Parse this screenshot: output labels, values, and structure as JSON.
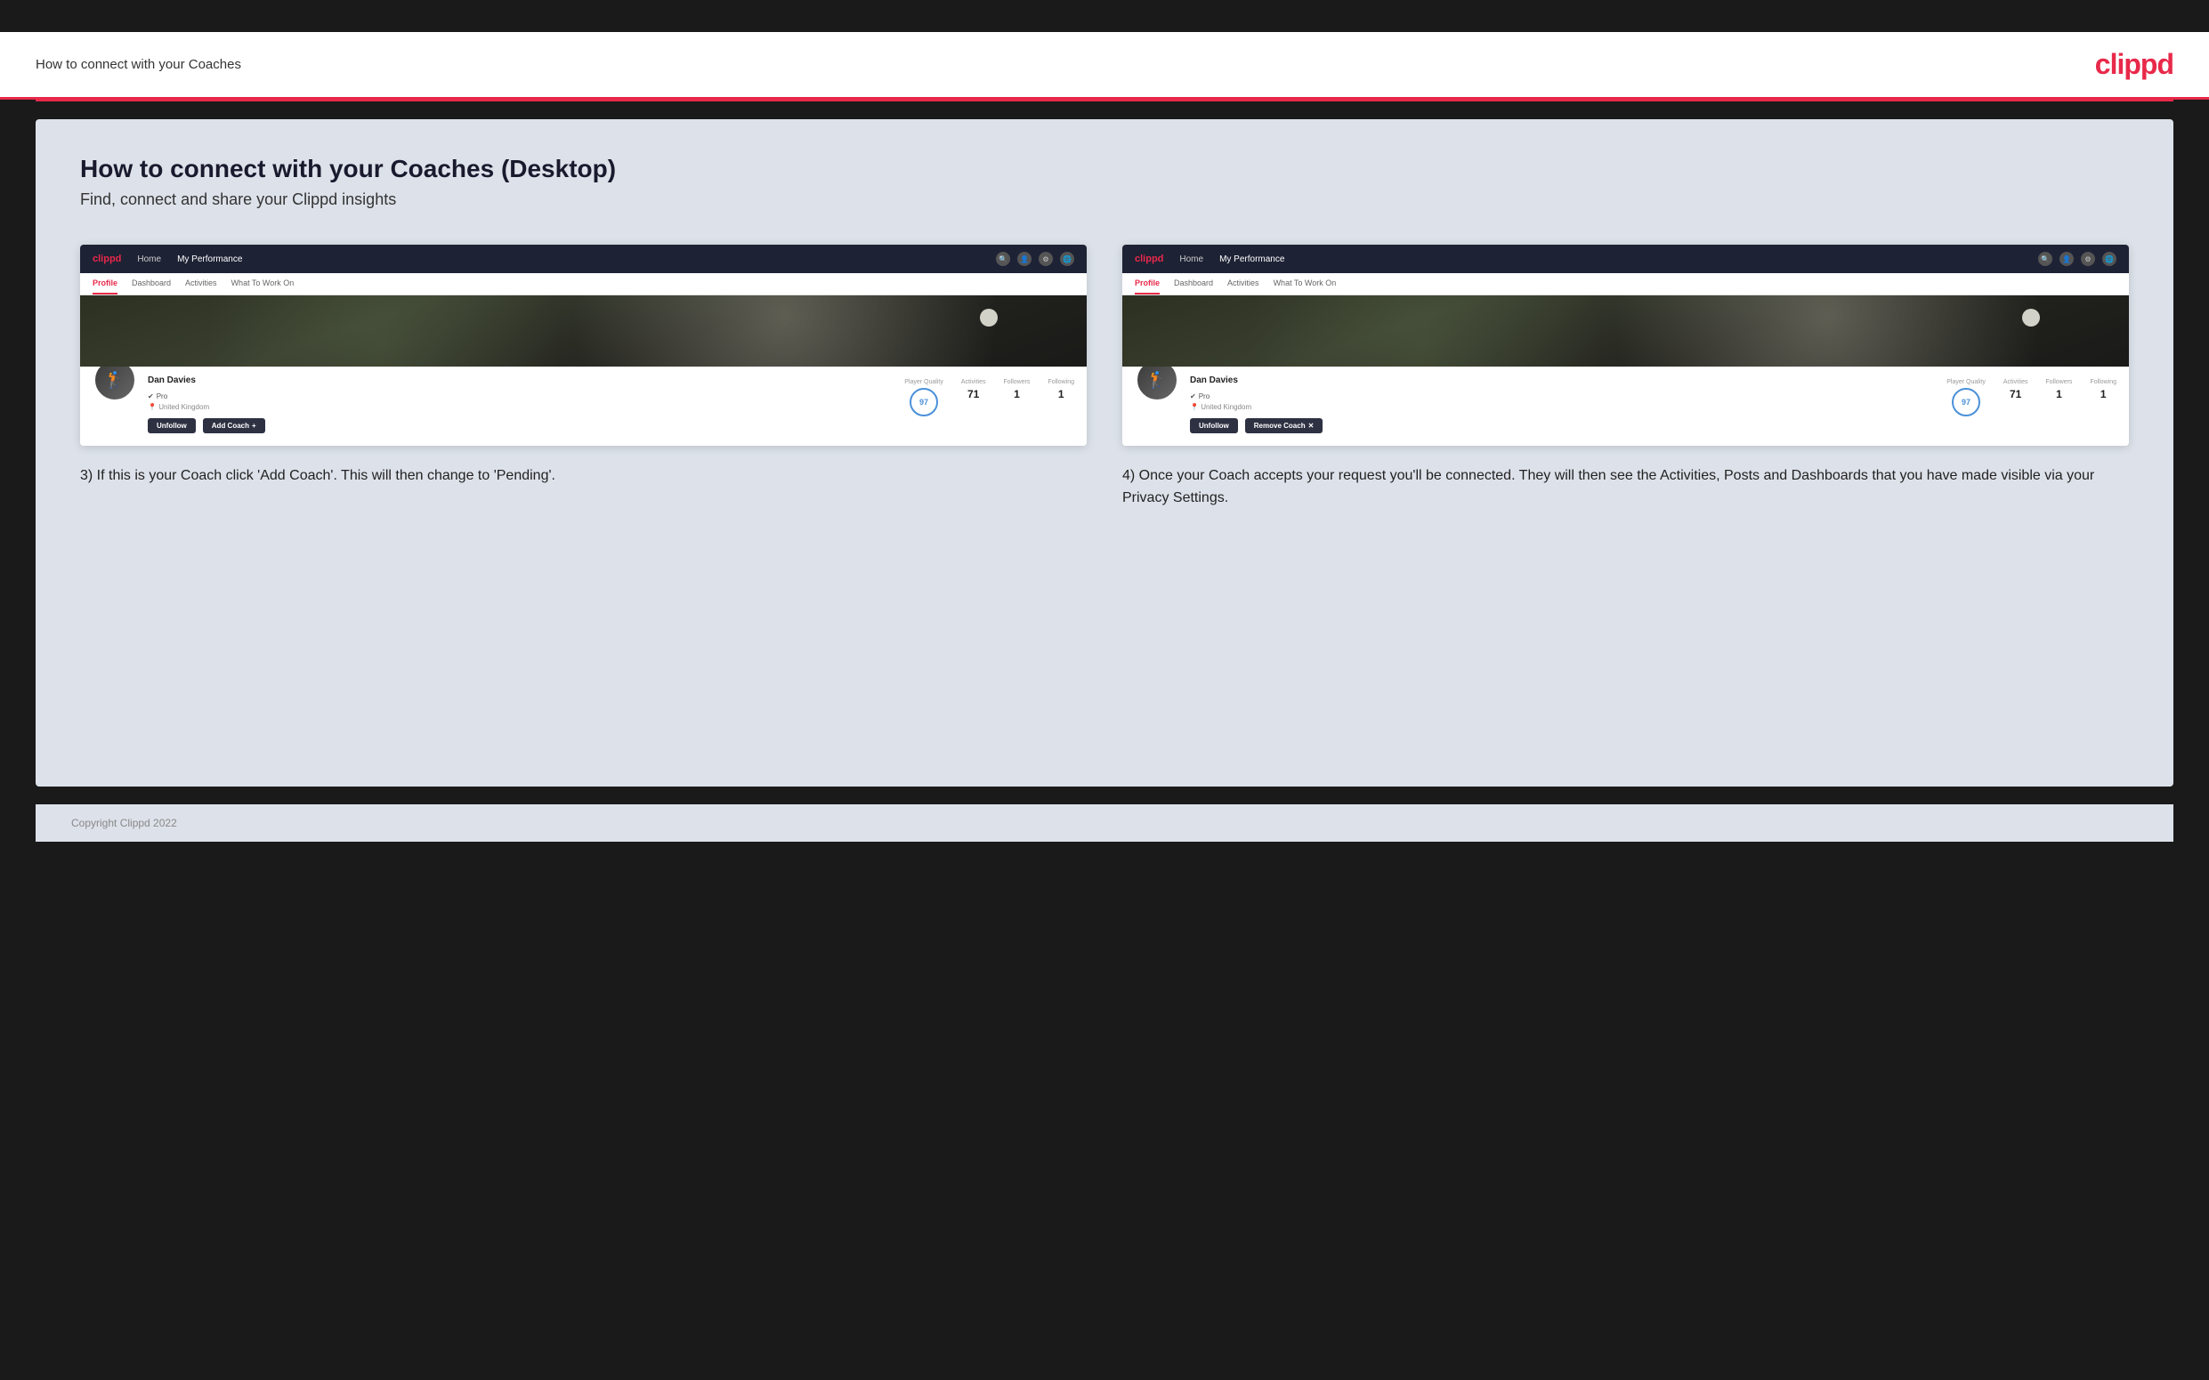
{
  "topbar": {},
  "header": {
    "title": "How to connect with your Coaches",
    "logo": "clippd"
  },
  "main": {
    "heading": "How to connect with your Coaches (Desktop)",
    "subheading": "Find, connect and share your Clippd insights",
    "screenshot1": {
      "nav": {
        "logo": "clippd",
        "items": [
          "Home",
          "My Performance"
        ]
      },
      "tabs": [
        "Profile",
        "Dashboard",
        "Activities",
        "What To Work On"
      ],
      "active_tab": "Profile",
      "profile": {
        "name": "Dan Davies",
        "badge": "Pro",
        "location": "United Kingdom",
        "stats": {
          "player_quality_label": "Player Quality",
          "player_quality_value": "97",
          "activities_label": "Activities",
          "activities_value": "71",
          "followers_label": "Followers",
          "followers_value": "1",
          "following_label": "Following",
          "following_value": "1"
        },
        "buttons": {
          "unfollow": "Unfollow",
          "add_coach": "Add Coach"
        }
      },
      "description": "3) If this is your Coach click 'Add Coach'. This will then change to 'Pending'."
    },
    "screenshot2": {
      "nav": {
        "logo": "clippd",
        "items": [
          "Home",
          "My Performance"
        ]
      },
      "tabs": [
        "Profile",
        "Dashboard",
        "Activities",
        "What To Work On"
      ],
      "active_tab": "Profile",
      "profile": {
        "name": "Dan Davies",
        "badge": "Pro",
        "location": "United Kingdom",
        "stats": {
          "player_quality_label": "Player Quality",
          "player_quality_value": "97",
          "activities_label": "Activities",
          "activities_value": "71",
          "followers_label": "Followers",
          "followers_value": "1",
          "following_label": "Following",
          "following_value": "1"
        },
        "buttons": {
          "unfollow": "Unfollow",
          "remove_coach": "Remove Coach"
        }
      },
      "description": "4) Once your Coach accepts your request you'll be connected. They will then see the Activities, Posts and Dashboards that you have made visible via your Privacy Settings."
    }
  },
  "footer": {
    "copyright": "Copyright Clippd 2022"
  }
}
